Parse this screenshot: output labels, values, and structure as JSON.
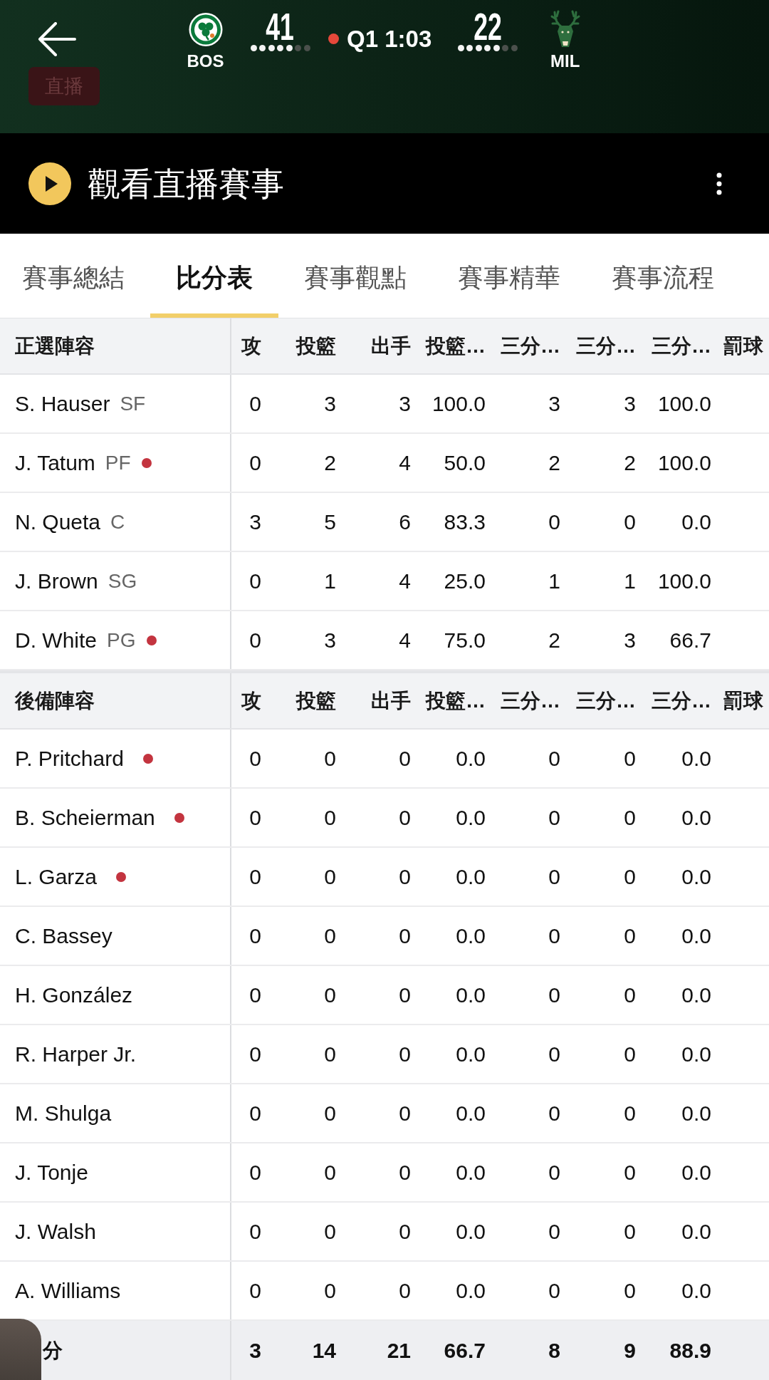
{
  "header": {
    "live_badge": "直播",
    "teams": [
      {
        "kind": "shamrock",
        "abbr": "BOS",
        "score": "41",
        "timeouts": [
          {
            "remaining": true
          },
          {
            "remaining": true
          },
          {
            "remaining": true
          },
          {
            "remaining": true
          },
          {
            "remaining": true
          },
          {
            "remaining": false
          },
          {
            "remaining": false
          }
        ]
      },
      {
        "kind": "deer",
        "abbr": "MIL",
        "score": "22",
        "timeouts": [
          {
            "remaining": true
          },
          {
            "remaining": true
          },
          {
            "remaining": true
          },
          {
            "remaining": true
          },
          {
            "remaining": true
          },
          {
            "remaining": false
          },
          {
            "remaining": false
          }
        ]
      }
    ],
    "clock": {
      "live": true,
      "text": "Q1 1:03"
    }
  },
  "watch_bar": {
    "title": "觀看直播賽事"
  },
  "tabs": [
    {
      "label": "賽事總結",
      "selected": false
    },
    {
      "label": "比分表",
      "selected": true
    },
    {
      "label": "賽事觀點",
      "selected": false
    },
    {
      "label": "賽事精華",
      "selected": false
    },
    {
      "label": "賽事流程",
      "selected": false
    }
  ],
  "sections": [
    {
      "title": "正選陣容",
      "columns": [
        "攻",
        "投籃",
        "出手",
        "投籃…",
        "三分…",
        "三分…",
        "三分…",
        "罰球"
      ],
      "rows": [
        {
          "name": "S. Hauser",
          "position": "SF",
          "on_court": false,
          "values": [
            "0",
            "3",
            "3",
            "100.0",
            "3",
            "3",
            "100.0"
          ]
        },
        {
          "name": "J. Tatum",
          "position": "PF",
          "on_court": true,
          "values": [
            "0",
            "2",
            "4",
            "50.0",
            "2",
            "2",
            "100.0"
          ]
        },
        {
          "name": "N. Queta",
          "position": "C",
          "on_court": false,
          "values": [
            "3",
            "5",
            "6",
            "83.3",
            "0",
            "0",
            "0.0"
          ]
        },
        {
          "name": "J. Brown",
          "position": "SG",
          "on_court": false,
          "values": [
            "0",
            "1",
            "4",
            "25.0",
            "1",
            "1",
            "100.0"
          ]
        },
        {
          "name": "D. White",
          "position": "PG",
          "on_court": true,
          "values": [
            "0",
            "3",
            "4",
            "75.0",
            "2",
            "3",
            "66.7"
          ]
        }
      ]
    },
    {
      "title": "後備陣容",
      "columns": [
        "攻",
        "投籃",
        "出手",
        "投籃…",
        "三分…",
        "三分…",
        "三分…",
        "罰球"
      ],
      "rows": [
        {
          "name": "P. Pritchard",
          "on_court": true,
          "values": [
            "0",
            "0",
            "0",
            "0.0",
            "0",
            "0",
            "0.0"
          ]
        },
        {
          "name": "B. Scheierman",
          "on_court": true,
          "values": [
            "0",
            "0",
            "0",
            "0.0",
            "0",
            "0",
            "0.0"
          ]
        },
        {
          "name": "L. Garza",
          "on_court": true,
          "values": [
            "0",
            "0",
            "0",
            "0.0",
            "0",
            "0",
            "0.0"
          ]
        },
        {
          "name": "C. Bassey",
          "on_court": false,
          "values": [
            "0",
            "0",
            "0",
            "0.0",
            "0",
            "0",
            "0.0"
          ]
        },
        {
          "name": "H. González",
          "on_court": false,
          "values": [
            "0",
            "0",
            "0",
            "0.0",
            "0",
            "0",
            "0.0"
          ]
        },
        {
          "name": "R. Harper Jr.",
          "on_court": false,
          "values": [
            "0",
            "0",
            "0",
            "0.0",
            "0",
            "0",
            "0.0"
          ]
        },
        {
          "name": "M. Shulga",
          "on_court": false,
          "values": [
            "0",
            "0",
            "0",
            "0.0",
            "0",
            "0",
            "0.0"
          ]
        },
        {
          "name": "J. Tonje",
          "on_court": false,
          "values": [
            "0",
            "0",
            "0",
            "0.0",
            "0",
            "0",
            "0.0"
          ]
        },
        {
          "name": "J. Walsh",
          "on_court": false,
          "values": [
            "0",
            "0",
            "0",
            "0.0",
            "0",
            "0",
            "0.0"
          ]
        },
        {
          "name": "A. Williams",
          "on_court": false,
          "values": [
            "0",
            "0",
            "0",
            "0.0",
            "0",
            "0",
            "0.0"
          ]
        }
      ]
    }
  ],
  "totals": {
    "label": "分",
    "values": [
      "3",
      "14",
      "21",
      "66.7",
      "8",
      "9",
      "88.9"
    ]
  }
}
